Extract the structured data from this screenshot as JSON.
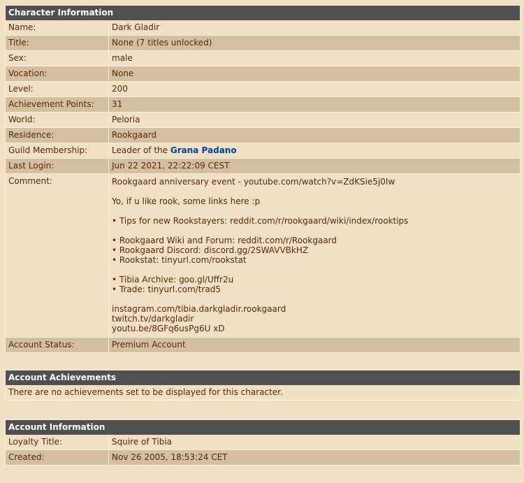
{
  "character_info": {
    "title": "Character Information",
    "rows": [
      {
        "label": "Name:",
        "value": "Dark Gladir"
      },
      {
        "label": "Title:",
        "value": "None (7 titles unlocked)"
      },
      {
        "label": "Sex:",
        "value": "male"
      },
      {
        "label": "Vocation:",
        "value": "None"
      },
      {
        "label": "Level:",
        "value": "200"
      },
      {
        "label": "Achievement Points:",
        "value": "31"
      },
      {
        "label": "World:",
        "value": "Peloria"
      },
      {
        "label": "Residence:",
        "value": "Rookgaard"
      }
    ],
    "guild": {
      "label": "Guild Membership:",
      "prefix": "Leader of the ",
      "link": "Grana Padano"
    },
    "last_login": {
      "label": "Last Login:",
      "value": "Jun 22 2021, 22:22:09 CEST"
    },
    "comment": {
      "label": "Comment:",
      "lines": [
        "Rookgaard anniversary event - youtube.com/watch?v=ZdKSie5j0Iw",
        "",
        "Yo, if u like rook, some links here :p",
        "",
        "• Tips for new Rookstayers: reddit.com/r/rookgaard/wiki/index/rooktips",
        "",
        "• Rookgaard Wiki and Forum: reddit.com/r/Rookgaard",
        "• Rookgaard Discord: discord.gg/2SWAVVBkHZ",
        "• Rookstat: tinyurl.com/rookstat",
        "",
        "• Tibia Archive: goo.gl/Uffr2u",
        "• Trade: tinyurl.com/trad5",
        "",
        "instagram.com/tibia.darkgladir.rookgaard",
        "twitch.tv/darkgladir",
        "youtu.be/8GFq6usPg6U xD"
      ]
    },
    "account_status": {
      "label": "Account Status:",
      "value": "Premium Account"
    }
  },
  "account_achievements": {
    "title": "Account Achievements",
    "message": "There are no achievements set to be displayed for this character."
  },
  "account_info": {
    "title": "Account Information",
    "rows": [
      {
        "label": "Loyalty Title:",
        "value": "Squire of Tibia"
      },
      {
        "label": "Created:",
        "value": "Nov 26 2005, 18:53:24 CET"
      }
    ]
  }
}
